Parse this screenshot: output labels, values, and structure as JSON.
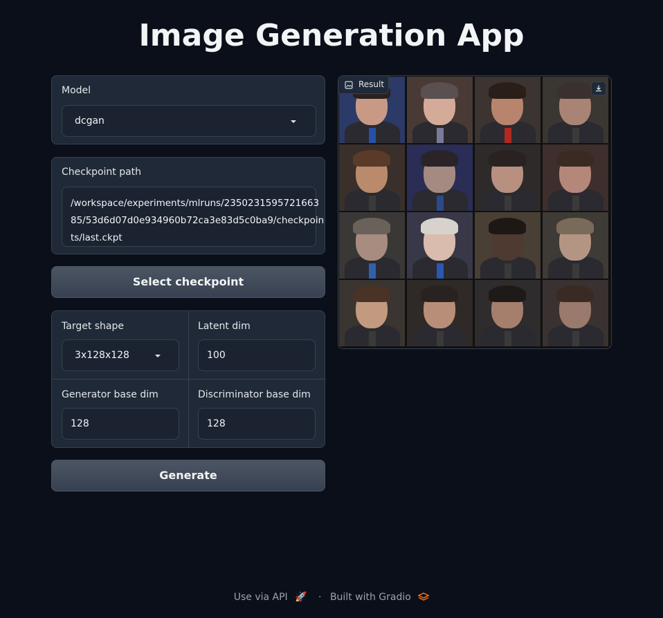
{
  "app": {
    "title": "Image Generation App"
  },
  "model": {
    "label": "Model",
    "value": "dcgan"
  },
  "checkpoint": {
    "label": "Checkpoint path",
    "line1": "/workspace/experiments/mlruns/2350231595721663",
    "line2": "85/53d6d07d0e934960b72ca3e83d5c0ba9/checkpoin",
    "line3": "ts/last.ckpt"
  },
  "select_button": {
    "label": "Select checkpoint"
  },
  "params": {
    "target_shape": {
      "label": "Target shape",
      "value": "3x128x128"
    },
    "latent_dim": {
      "label": "Latent dim",
      "value": "100"
    },
    "generator_base_dim": {
      "label": "Generator base dim",
      "value": "128"
    },
    "discriminator_base_dim": {
      "label": "Discriminator base dim",
      "value": "128"
    }
  },
  "generate_button": {
    "label": "Generate"
  },
  "result": {
    "label": "Result",
    "icon": "image-icon",
    "download_icon": "download-icon"
  },
  "footer": {
    "api": "Use via API",
    "separator": "·",
    "built": "Built with Gradio"
  },
  "colors": {
    "background": "#0b0f19",
    "panel": "#1f2937",
    "border": "#374151",
    "accent": "#f97316"
  }
}
